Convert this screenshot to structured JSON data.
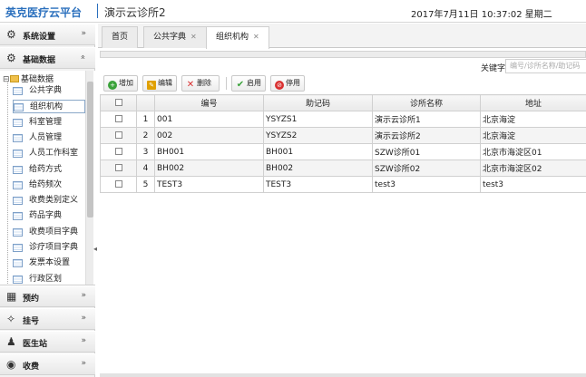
{
  "header": {
    "brand": "英克医疗云平台",
    "clinic": "演示云诊所2",
    "datetime": "2017年7月11日 10:37:02 星期二"
  },
  "sidebar": {
    "sections_top": [
      {
        "label": "系统设置",
        "icon": "gear-icon"
      },
      {
        "label": "基础数据",
        "icon": "settings-icon"
      }
    ],
    "tree_root": "基础数据",
    "tree_items": [
      "公共字典",
      "组织机构",
      "科室管理",
      "人员管理",
      "人员工作科室",
      "给药方式",
      "给药频次",
      "收费类别定义",
      "药品字典",
      "收费项目字典",
      "诊疗项目字典",
      "发票本设置",
      "行政区划"
    ],
    "active_item": "组织机构",
    "sections_bottom": [
      {
        "label": "预约",
        "icon": "calendar-icon"
      },
      {
        "label": "挂号",
        "icon": "register-icon"
      },
      {
        "label": "医生站",
        "icon": "doctor-icon"
      },
      {
        "label": "收费",
        "icon": "money-icon"
      }
    ]
  },
  "tabs": [
    {
      "label": "首页",
      "closable": false
    },
    {
      "label": "公共字典",
      "closable": true
    },
    {
      "label": "组织机构",
      "closable": true,
      "active": true
    }
  ],
  "toolbar": {
    "keyword_label": "关键字",
    "keyword_placeholder": "编号/诊所名称/助记码",
    "buttons": [
      {
        "label": "增加",
        "icon": "add-icon",
        "color": "#3aa23a"
      },
      {
        "label": "编辑",
        "icon": "edit-icon",
        "color": "#e0a000"
      },
      {
        "label": "删除",
        "icon": "delete-icon",
        "color": "#d93030"
      },
      {
        "label": "启用",
        "icon": "check-icon",
        "color": "#3aa23a"
      },
      {
        "label": "停用",
        "icon": "stop-icon",
        "color": "#d93030"
      }
    ]
  },
  "grid": {
    "columns": [
      "编号",
      "助记码",
      "诊所名称",
      "地址"
    ],
    "rows": [
      {
        "n": "1",
        "code": "001",
        "mnemonic": "YSYZS1",
        "name": "演示云诊所1",
        "address": "北京海淀"
      },
      {
        "n": "2",
        "code": "002",
        "mnemonic": "YSYZS2",
        "name": "演示云诊所2",
        "address": "北京海淀"
      },
      {
        "n": "3",
        "code": "BH001",
        "mnemonic": "BH001",
        "name": "SZW诊所01",
        "address": "北京市海淀区01"
      },
      {
        "n": "4",
        "code": "BH002",
        "mnemonic": "BH002",
        "name": "SZW诊所02",
        "address": "北京市海淀区02"
      },
      {
        "n": "5",
        "code": "TEST3",
        "mnemonic": "TEST3",
        "name": "test3",
        "address": "test3"
      }
    ]
  }
}
